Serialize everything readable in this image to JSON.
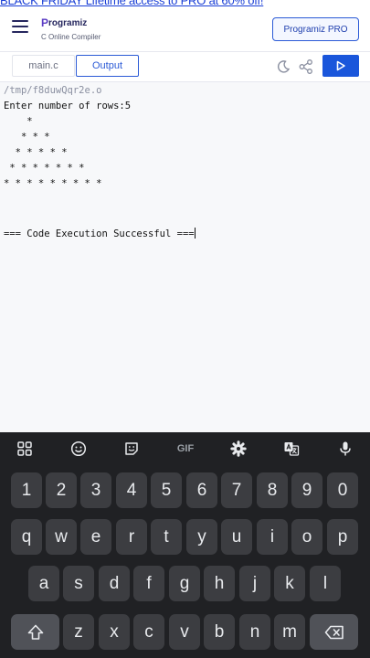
{
  "promo": {
    "text": "BLACK FRIDAY Lifetime access to PRO at 60% off!"
  },
  "header": {
    "brand_name": "rogramiz",
    "brand_mark": "P",
    "brand_sub": "C Online Compiler",
    "pro_label": "Programiz PRO"
  },
  "toolbar": {
    "tab_main": "main.c",
    "tab_output": "Output"
  },
  "output": {
    "lines": [
      "/tmp/f8duwQqr2e.o",
      "Enter number of rows:5",
      "    *",
      "   * * *",
      "  * * * * *",
      " * * * * * * *",
      "* * * * * * * * *",
      "",
      "",
      "",
      "=== Code Execution Successful ==="
    ]
  },
  "keyboard": {
    "row_numbers": [
      "1",
      "2",
      "3",
      "4",
      "5",
      "6",
      "7",
      "8",
      "9",
      "0"
    ],
    "row_q": [
      "q",
      "w",
      "e",
      "r",
      "t",
      "y",
      "u",
      "i",
      "o",
      "p"
    ],
    "row_a": [
      "a",
      "s",
      "d",
      "f",
      "g",
      "h",
      "j",
      "k",
      "l"
    ],
    "row_z": [
      "z",
      "x",
      "c",
      "v",
      "b",
      "n",
      "m"
    ],
    "gif_label": "GIF"
  },
  "colors": {
    "accent": "#1a56db",
    "brand": "#25265e",
    "keyboard_bg": "#202124",
    "key_bg": "#3c3d41"
  }
}
